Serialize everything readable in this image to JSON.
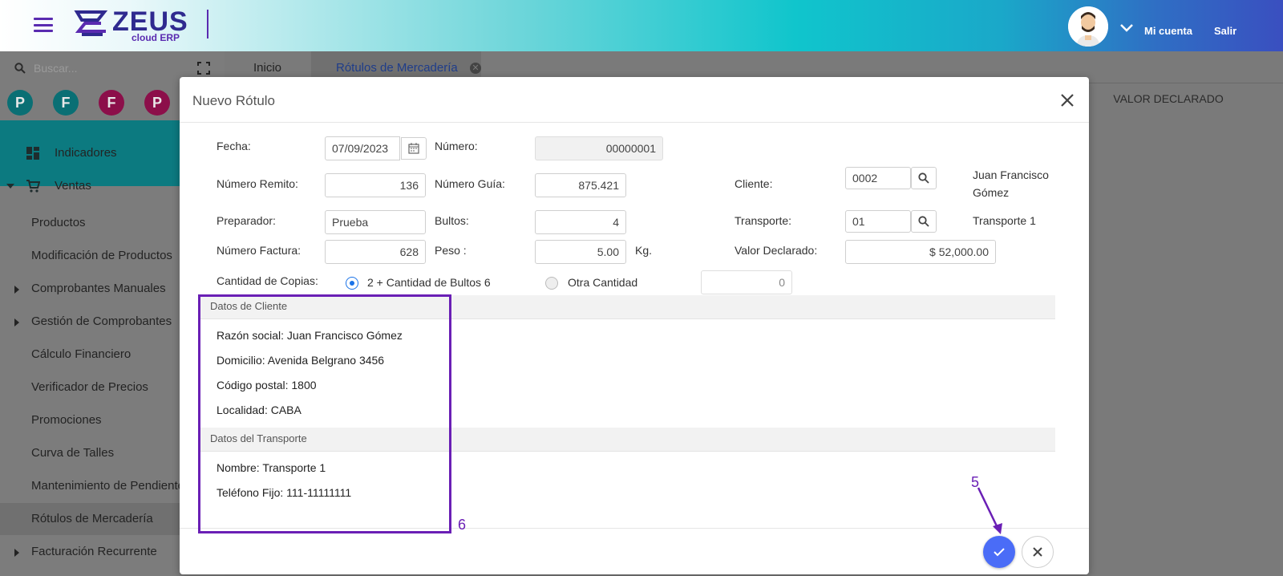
{
  "app": {
    "logo_text": "ZEUS",
    "logo_sub": "cloud ERP",
    "nav": {
      "account": "Mi cuenta",
      "logout": "Salir"
    }
  },
  "sidebar": {
    "search_placeholder": "Buscar...",
    "shortcuts": [
      {
        "letter": "P",
        "color": "#0a6f74"
      },
      {
        "letter": "F",
        "color": "#0a6f74"
      },
      {
        "letter": "F",
        "color": "#8c0f4a"
      },
      {
        "letter": "P",
        "color": "#8c0f4a"
      }
    ],
    "sections": [
      {
        "label": "Indicadores",
        "icon": "dashboard-icon"
      },
      {
        "label": "Ventas",
        "icon": "cart-icon"
      }
    ],
    "items": [
      {
        "label": "Productos",
        "arrow": false
      },
      {
        "label": "Modificación de Productos",
        "arrow": false
      },
      {
        "label": "Comprobantes Manuales",
        "arrow": true
      },
      {
        "label": "Gestión de Comprobantes",
        "arrow": true
      },
      {
        "label": "Cálculo Financiero",
        "arrow": false
      },
      {
        "label": "Verificador de Precios",
        "arrow": false
      },
      {
        "label": "Promociones",
        "arrow": false
      },
      {
        "label": "Curva de Talles",
        "arrow": false
      },
      {
        "label": "Mantenimiento de Pendientes",
        "arrow": false
      },
      {
        "label": "Rótulos de Mercadería",
        "arrow": false
      },
      {
        "label": "Facturación Recurrente",
        "arrow": true
      }
    ]
  },
  "tabs": [
    {
      "label": "Inicio"
    },
    {
      "label": "Rótulos de Mercadería"
    }
  ],
  "table": {
    "visible_header": "VALOR DECLARADO"
  },
  "modal": {
    "title": "Nuevo Rótulo",
    "fields": {
      "fecha": {
        "label": "Fecha:",
        "value": "07/09/2023"
      },
      "numero": {
        "label": "Número:",
        "value": "00000001"
      },
      "numero_remito": {
        "label": "Número Remito:",
        "value": "136"
      },
      "numero_guia": {
        "label": "Número Guía:",
        "value": "875.421"
      },
      "cliente": {
        "label": "Cliente:",
        "value": "0002",
        "name_line1": "Juan Francisco",
        "name_line2": "Gómez"
      },
      "preparador": {
        "label": "Preparador:",
        "value": "Prueba"
      },
      "bultos": {
        "label": "Bultos:",
        "value": "4"
      },
      "transporte": {
        "label": "Transporte:",
        "value": "01",
        "name": "Transporte 1"
      },
      "numero_factura": {
        "label": "Número Factura:",
        "value": "628"
      },
      "peso": {
        "label": "Peso :",
        "value": "5.00",
        "unit": "Kg."
      },
      "valor_declarado": {
        "label": "Valor Declarado:",
        "value": "$ 52,000.00"
      },
      "cantidad_copias": {
        "label": "Cantidad de Copias:",
        "option1": "2 + Cantidad de Bultos 6",
        "option2": "Otra Cantidad",
        "other_value": "0"
      }
    },
    "cliente_panel": {
      "title": "Datos de Cliente",
      "lines": [
        "Razón social: Juan Francisco Gómez",
        "Domicilio: Avenida Belgrano 3456",
        "Código postal: 1800",
        "Localidad: CABA"
      ]
    },
    "transporte_panel": {
      "title": "Datos del Transporte",
      "lines": [
        "Nombre: Transporte 1",
        "Teléfono Fijo: 111-11111111"
      ]
    }
  },
  "annotations": {
    "step5": "5",
    "step6": "6",
    "color": "#6a1fb5"
  }
}
